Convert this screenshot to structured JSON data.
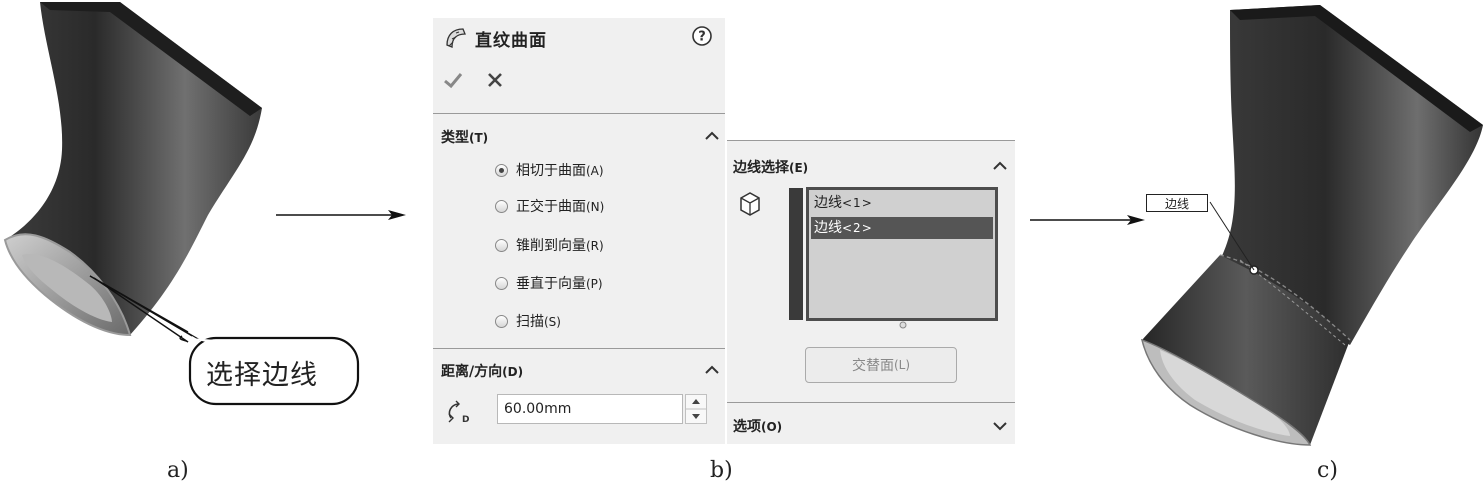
{
  "panel": {
    "title": "直纹曲面",
    "help_icon": "help-icon",
    "ok_icon": "checkmark-icon",
    "cancel_icon": "close-icon"
  },
  "type_group": {
    "title": "类型",
    "shortcut": "(T)",
    "options": [
      {
        "label": "相切于曲面",
        "shortcut": "(A)",
        "selected": true
      },
      {
        "label": "正交于曲面",
        "shortcut": "(N)",
        "selected": false
      },
      {
        "label": "锥削到向量",
        "shortcut": "(R)",
        "selected": false
      },
      {
        "label": "垂直于向量",
        "shortcut": "(P)",
        "selected": false
      },
      {
        "label": "扫描",
        "shortcut": "(S)",
        "selected": false
      }
    ]
  },
  "distance_group": {
    "title": "距离/方向",
    "shortcut": "(D)",
    "value": "60.00mm"
  },
  "edge_group": {
    "title": "边线选择",
    "shortcut": "(E)",
    "items": [
      {
        "label": "边线",
        "suffix": "<1>",
        "selected": false
      },
      {
        "label": "边线",
        "suffix": "<2>",
        "selected": true
      }
    ],
    "alt_face_button": "交替面",
    "alt_face_shortcut": "(L)"
  },
  "options_group": {
    "title": "选项",
    "shortcut": "(O)"
  },
  "figure": {
    "callout": "选择边线",
    "edge_tag": "边线",
    "captions": [
      "a)",
      "b)",
      "c)"
    ]
  },
  "colors": {
    "panel_bg": "#f0f0f0",
    "selected_item": "#555555",
    "list_bg": "#d0d0d0",
    "model_dark": "#2a2a2a"
  }
}
